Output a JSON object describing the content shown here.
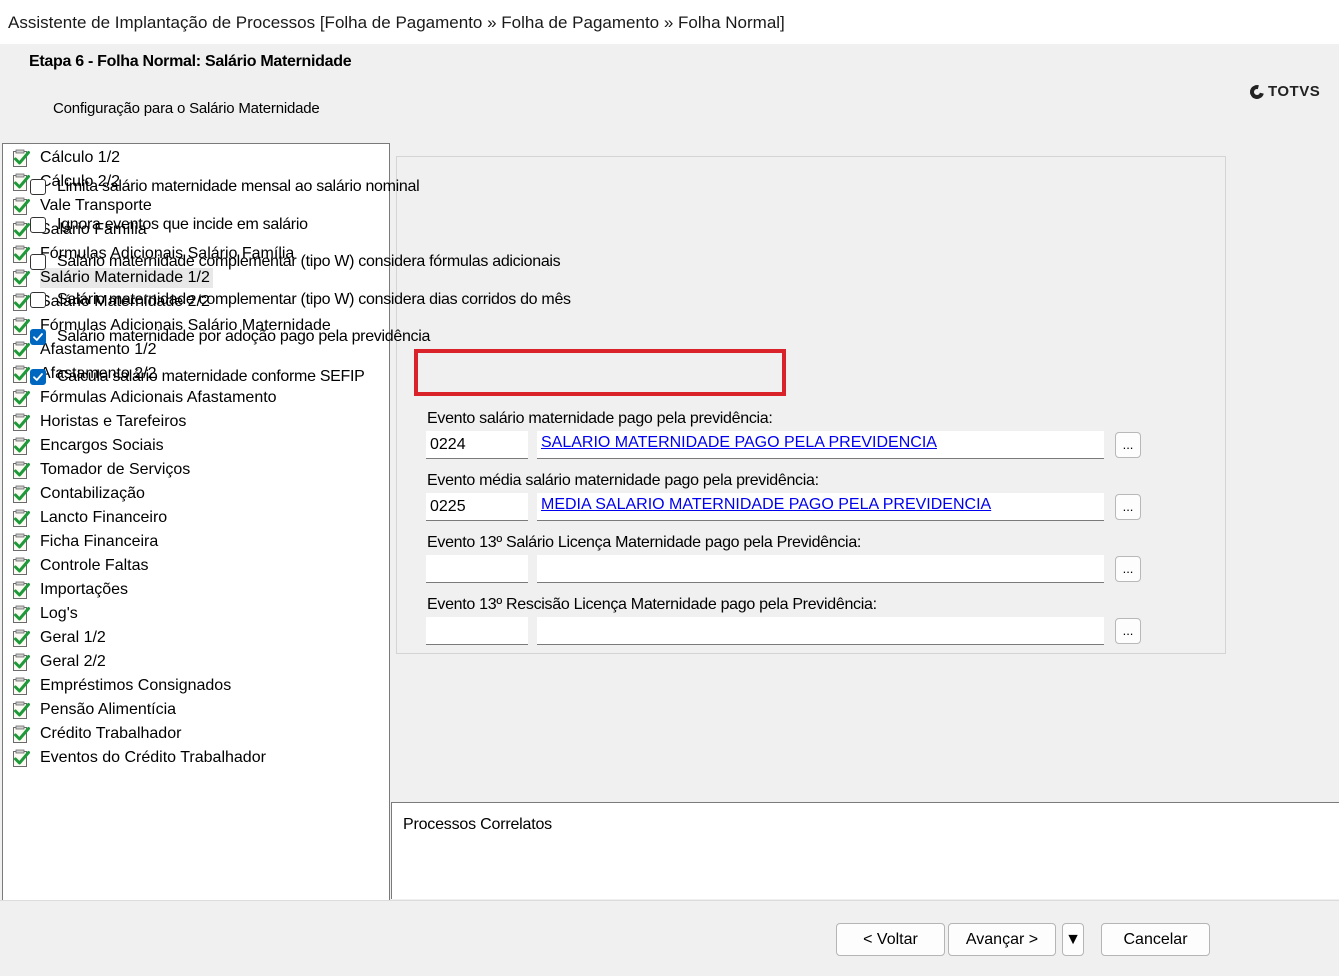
{
  "window": {
    "title": "Assistente de Implantação de Processos [Folha de Pagamento » Folha de Pagamento » Folha Normal]"
  },
  "header": {
    "step_title": "Etapa 6 - Folha Normal: Salário Maternidade",
    "subtitle": "Configuração para o Salário Maternidade",
    "logo_text": "TOTVS"
  },
  "sidebar": {
    "items": [
      {
        "label": "Cálculo 1/2",
        "done": true
      },
      {
        "label": "Cálculo 2/2",
        "done": true
      },
      {
        "label": "Vale Transporte",
        "done": true
      },
      {
        "label": "Salário Família",
        "done": true
      },
      {
        "label": "Fórmulas Adicionais Salário Família",
        "done": true
      },
      {
        "label": "Salário Maternidade 1/2",
        "done": true,
        "selected": true
      },
      {
        "label": "Salário Maternidade 2/2",
        "done": true
      },
      {
        "label": "Fórmulas Adicionais Salário Maternidade",
        "done": true
      },
      {
        "label": "Afastamento 1/2",
        "done": true
      },
      {
        "label": "Afastamento 2/2",
        "done": true
      },
      {
        "label": "Fórmulas Adicionais Afastamento",
        "done": true
      },
      {
        "label": "Horistas e Tarefeiros",
        "done": true
      },
      {
        "label": "Encargos Sociais",
        "done": true
      },
      {
        "label": "Tomador de Serviços",
        "done": true
      },
      {
        "label": "Contabilização",
        "done": true
      },
      {
        "label": "Lancto Financeiro",
        "done": true
      },
      {
        "label": "Ficha Financeira",
        "done": true
      },
      {
        "label": "Controle Faltas",
        "done": true
      },
      {
        "label": "Importações",
        "done": true
      },
      {
        "label": "Log's",
        "done": true
      },
      {
        "label": "Geral 1/2",
        "done": true
      },
      {
        "label": "Geral 2/2",
        "done": true
      },
      {
        "label": "Empréstimos Consignados",
        "done": true
      },
      {
        "label": "Pensão Alimentícia",
        "done": true
      },
      {
        "label": "Crédito Trabalhador",
        "done": true
      },
      {
        "label": "Eventos do Crédito Trabalhador",
        "done": true
      }
    ]
  },
  "options": {
    "limita": {
      "label": "Limita salário maternidade mensal ao salário nominal",
      "checked": false
    },
    "ignora": {
      "label": "Ignora eventos que incide em salário",
      "checked": false
    },
    "complementar_formulas": {
      "label": "Salário maternidade complementar (tipo W) considera fórmulas adicionais",
      "checked": false
    },
    "complementar_dias": {
      "label": "Salário maternidade complementar (tipo W) considera dias corridos do mês",
      "checked": false
    },
    "adocao": {
      "label": "Salário maternidade por adoção pago pela previdência",
      "checked": true
    },
    "sefip": {
      "label": "Calcula salário maternidade conforme SEFIP",
      "checked": true
    }
  },
  "fields": {
    "evento_pago": {
      "label": "Evento salário maternidade pago pela previdência:",
      "code": "0224",
      "description": "SALARIO MATERNIDADE PAGO PELA PREVIDENCIA",
      "browse": "..."
    },
    "evento_media": {
      "label": "Evento média salário maternidade pago pela previdência:",
      "code": "0225",
      "description": "MEDIA SALARIO MATERNIDADE PAGO PELA PREVIDENCIA",
      "browse": "..."
    },
    "evento_13_salario": {
      "label": "Evento 13º Salário Licença Maternidade pago pela Previdência:",
      "code": "",
      "description": "",
      "browse": "..."
    },
    "evento_13_rescisao": {
      "label": "Evento 13º Rescisão Licença Maternidade pago pela Previdência:",
      "code": "",
      "description": "",
      "browse": "..."
    }
  },
  "related": {
    "label": "Processos Correlatos"
  },
  "footer": {
    "back_label": "< Voltar",
    "next_label": "Avançar >",
    "split_label": "▼",
    "cancel_label": "Cancelar"
  },
  "colors": {
    "accent": "#0067c0",
    "highlight": "#d9222a",
    "link": "#0000ee",
    "check_green": "#1f9a3a"
  }
}
